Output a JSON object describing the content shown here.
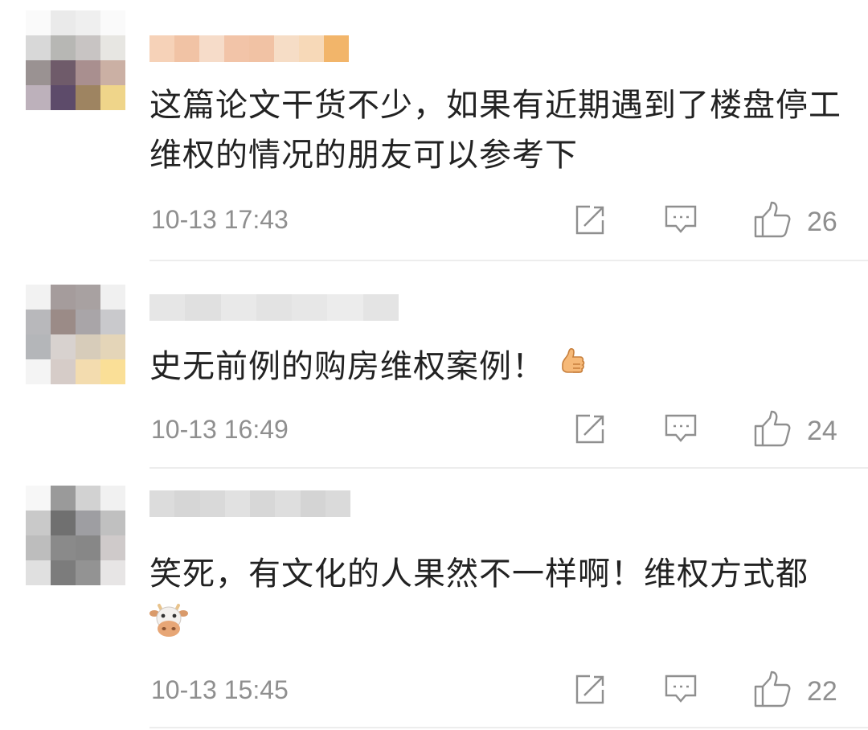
{
  "comments": [
    {
      "text": "这篇论文干货不少，如果有近期遇到了楼盘停工维权的情况的朋友可以参考下",
      "time": "10-13 17:43",
      "likes": "26"
    },
    {
      "text": "史无前例的购房维权案例！",
      "emoji": "thumbs-up-emoji",
      "time": "10-13 16:49",
      "likes": "24"
    },
    {
      "text": "笑死，有文化的人果然不一样啊！维权方式都",
      "emoji": "cow-face-emoji",
      "time": "10-13 15:45",
      "likes": "22"
    }
  ],
  "icons": {
    "share": "share-icon",
    "comment": "comment-icon",
    "like": "like-icon"
  },
  "colors": {
    "meta_text": "#8f8f8f",
    "body_text": "#222222",
    "divider": "#ededed"
  }
}
